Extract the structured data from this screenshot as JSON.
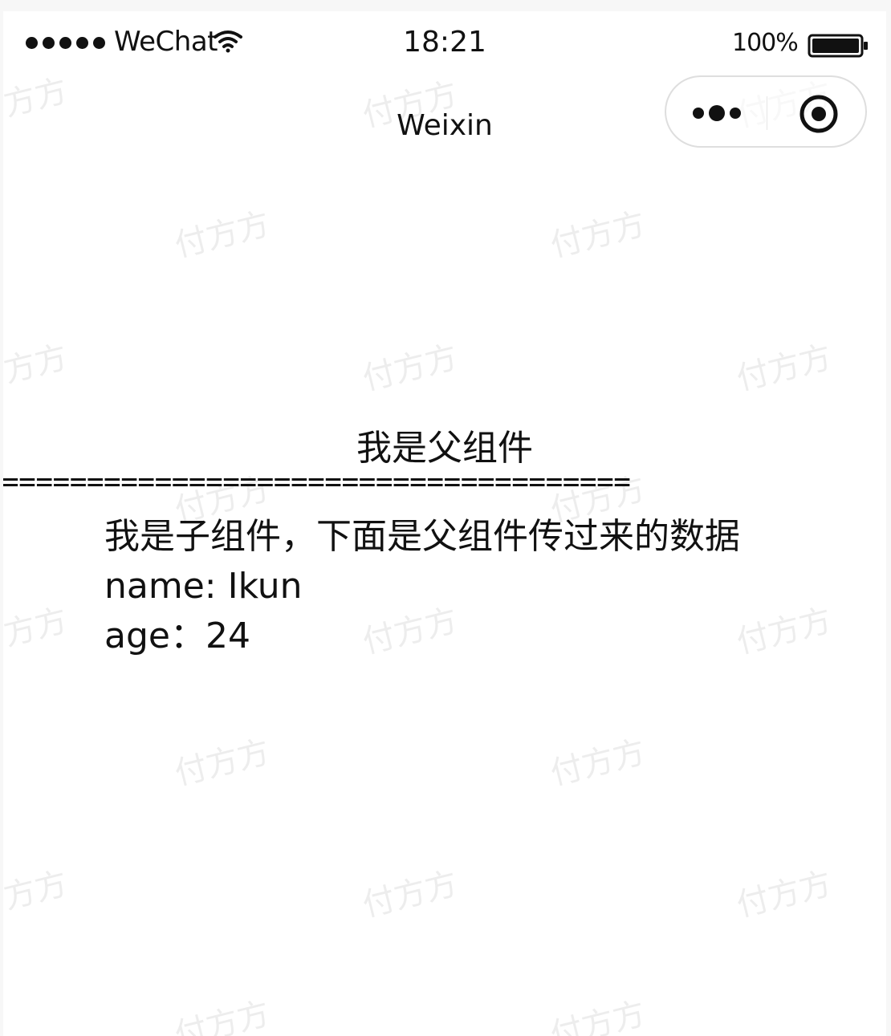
{
  "status_bar": {
    "carrier": "WeChat",
    "time": "18:21",
    "battery": "100%",
    "signal_icon": "signal-dots-icon",
    "wifi_icon": "wifi-icon",
    "battery_icon": "battery-icon"
  },
  "nav": {
    "title": "Weixin",
    "more_icon": "more-icon",
    "close_icon": "close-icon"
  },
  "watermark": "付方方",
  "content": {
    "parent_text": "我是父组件",
    "separator": "=====================================",
    "child_heading": "我是子组件，下面是父组件传过来的数据",
    "name_line": "name: Ikun",
    "age_line": "age：24"
  }
}
